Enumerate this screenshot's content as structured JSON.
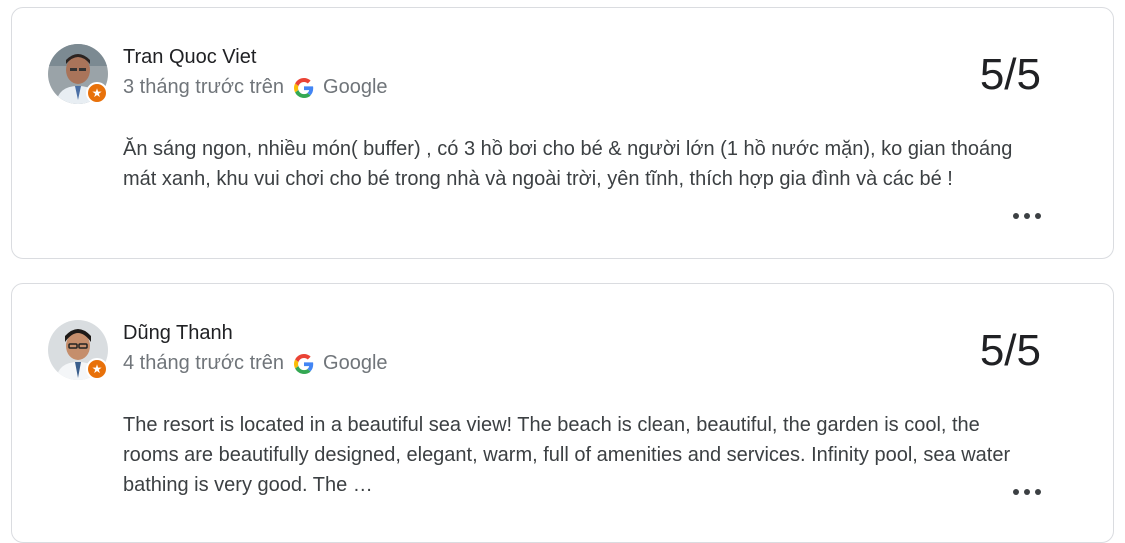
{
  "reviews": [
    {
      "name": "Tran Quoc Viet",
      "time": "3 tháng trước trên",
      "source": "Google",
      "rating": "5/5",
      "text": "Ăn sáng ngon, nhiều món( buffer) , có 3 hồ bơi cho bé & người lớn (1 hồ nước mặn), ko gian thoáng mát xanh, khu vui chơi cho bé trong nhà và ngoài trời, yên tĩnh, thích hợp gia đình và các bé !",
      "badge_icon": "star-icon",
      "more_icon": "more-horizontal-icon"
    },
    {
      "name": "Dũng Thanh",
      "time": "4 tháng trước trên",
      "source": "Google",
      "rating": "5/5",
      "text": "The resort is located in a beautiful sea view! The beach is clean, beautiful, the garden is cool, the rooms are beautifully designed, elegant, warm, full of amenities and services. Infinity pool, sea water bathing is very good. The …",
      "badge_icon": "star-icon",
      "more_icon": "more-horizontal-icon"
    }
  ],
  "colors": {
    "badge": "#e8710a",
    "border": "#dadce0",
    "meta_text": "#70757a"
  }
}
